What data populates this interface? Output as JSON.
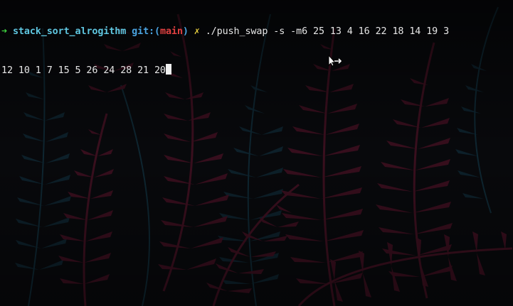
{
  "prompt": {
    "arrow": "➜",
    "directory": "stack_sort_alrogithm",
    "git_label": "git:",
    "paren_open": "(",
    "branch": "main",
    "paren_close": ")",
    "dirty_marker": "✗"
  },
  "command": {
    "text": " ./push_swap -s -m6 25 13 4 16 22 18 14 19 3",
    "continuation": "12 10 1 7 15 5 26 24 28 21 20"
  },
  "colors": {
    "arrow": "#3fd13f",
    "directory": "#5fc6e0",
    "git": "#4aa3e0",
    "branch": "#e04040",
    "dirty": "#e8d040",
    "text": "#e6e6e6",
    "background": "#07080b",
    "fern_red": "#3a0f1e",
    "fern_teal": "#0e2530"
  },
  "icons": {
    "cursor": "block-cursor-icon",
    "pointer": "resize-arrow-pointer-icon"
  }
}
